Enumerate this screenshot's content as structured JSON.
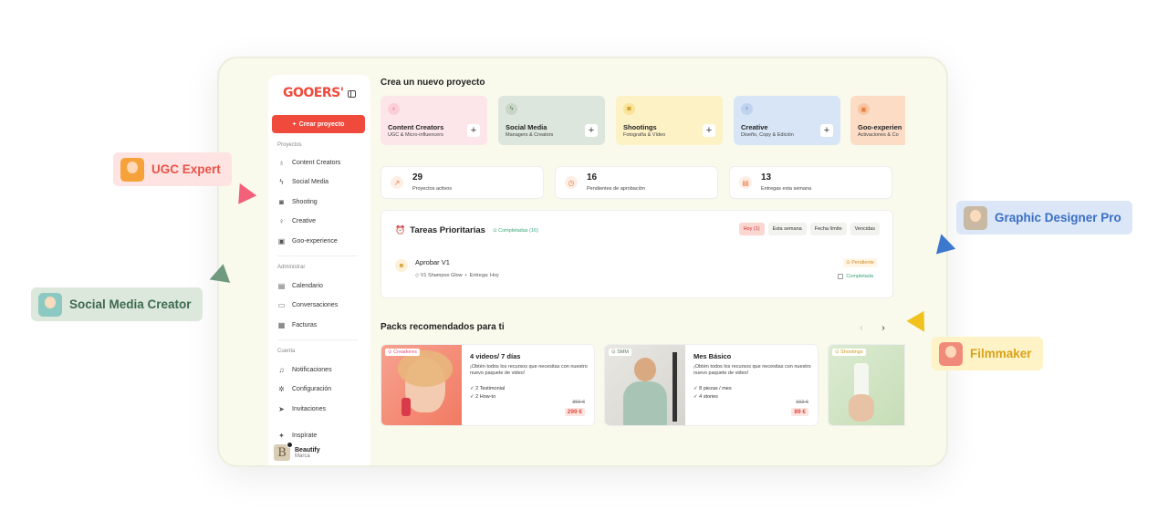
{
  "sidebar": {
    "logo": "GOOERS'",
    "create_button": "Crear proyecto",
    "sections": {
      "projects": "Proyectos",
      "admin": "Administrar",
      "account": "Cuenta"
    },
    "project_items": [
      {
        "label": "Content Creators",
        "icon": "flame-icon"
      },
      {
        "label": "Social Media",
        "icon": "zap-icon"
      },
      {
        "label": "Shooting",
        "icon": "camera-icon"
      },
      {
        "label": "Creative",
        "icon": "lightbulb-icon"
      },
      {
        "label": "Goo-experience",
        "icon": "calendar-star-icon"
      }
    ],
    "admin_items": [
      {
        "label": "Calendario",
        "icon": "calendar-icon"
      },
      {
        "label": "Conversaciones",
        "icon": "chat-icon"
      },
      {
        "label": "Facturas",
        "icon": "invoice-icon"
      }
    ],
    "account_items": [
      {
        "label": "Notificaciones",
        "icon": "bell-icon"
      },
      {
        "label": "Configuración",
        "icon": "gear-icon"
      },
      {
        "label": "Invitaciones",
        "icon": "send-icon"
      }
    ],
    "inspirate": "Inspírate",
    "brand": {
      "name": "Beautify",
      "sub": "Marca",
      "initial": "B"
    }
  },
  "main": {
    "new_project_title": "Crea un nuevo proyecto",
    "categories": [
      {
        "title": "Content Creators",
        "sub": "UGC & Micro-influencers",
        "bg": "#fde6ea",
        "icon_bg": "#fbcfd8",
        "icon_color": "#e0507a"
      },
      {
        "title": "Social Media",
        "sub": "Managers & Creators",
        "bg": "#dde6dc",
        "icon_bg": "#c8d6c6",
        "icon_color": "#5c7a5a"
      },
      {
        "title": "Shootings",
        "sub": "Fotografía & Vídeo",
        "bg": "#fdf1c6",
        "icon_bg": "#f9e39a",
        "icon_color": "#c99a1a"
      },
      {
        "title": "Creative",
        "sub": "Diseño, Copy & Edición",
        "bg": "#d8e5f6",
        "icon_bg": "#bfd3ef",
        "icon_color": "#4a78c0"
      },
      {
        "title": "Goo-experien",
        "sub": "Activaciones & Co",
        "bg": "#fcdcc5",
        "icon_bg": "#f9c6a3",
        "icon_color": "#e0793a"
      }
    ],
    "stats": [
      {
        "value": "29",
        "label": "Proyectos activos",
        "icon": "trend-up-icon"
      },
      {
        "value": "16",
        "label": "Pendientes de aprobación",
        "icon": "clock-icon"
      },
      {
        "value": "13",
        "label": "Entregas esta semana",
        "icon": "calendar-icon"
      }
    ],
    "tasks": {
      "title": "Tareas Prioritarias",
      "completed": "Completadas (16)",
      "filters": [
        "Hoy (1)",
        "Esta semana",
        "Fecha límite",
        "Vencidas"
      ],
      "item": {
        "name": "Aprobar V1",
        "meta": "V1 Shampoo Glow",
        "delivery": "Entrega: Hoy",
        "status": "Pendiente",
        "action": "Completada"
      }
    },
    "packs": {
      "title": "Packs recomendados para ti",
      "items": [
        {
          "tag": "Creadores",
          "title": "4 videos/ 7 días",
          "desc": "¡Obtén todos los recursos que necesitas con nuestro nuevo paquete de video!",
          "features": [
            "2 Testimonial",
            "2 How-to"
          ],
          "old_price": "360 €",
          "price": "299 €"
        },
        {
          "tag": "SMM",
          "title": "Mes Básico",
          "desc": "¡Obtén todos los recursos que necesitas con nuestro nuevo paquete de video!",
          "features": [
            "8 piezas / mes",
            "4 stories"
          ],
          "old_price": "102 €",
          "price": "89 €"
        },
        {
          "tag": "Shootings"
        }
      ]
    }
  },
  "badges": [
    {
      "label": "UGC Expert",
      "color": "#e8534a",
      "bg": "#fde3e1"
    },
    {
      "label": "Social Media Creator",
      "color": "#3d6a4f",
      "bg": "#dde8dc"
    },
    {
      "label": "Graphic Designer Pro",
      "color": "#3a6fc4",
      "bg": "#dbe6f7"
    },
    {
      "label": "Filmmaker",
      "color": "#d9a21a",
      "bg": "#fdf3c6"
    }
  ]
}
